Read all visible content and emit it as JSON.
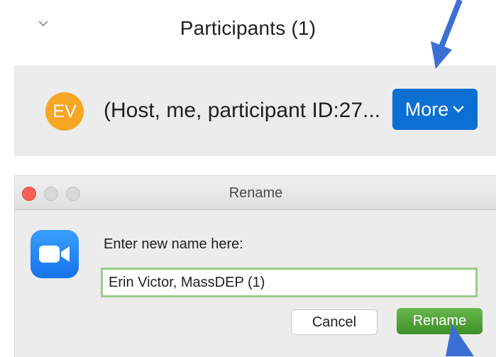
{
  "participants_panel": {
    "title": "Participants (1)",
    "participant": {
      "initials": "EV",
      "name_text": "(Host, me, participant ID:27...",
      "avatar_color": "#f5a623"
    },
    "more_button_label": "More"
  },
  "rename_dialog": {
    "title": "Rename",
    "prompt": "Enter new name here:",
    "name_value": "Erin Victor, MassDEP (1)",
    "cancel_label": "Cancel",
    "rename_label": "Rename"
  },
  "colors": {
    "accent_blue": "#0b6fd3",
    "rename_green": "#4ea535",
    "arrow_blue": "#3b6fd4"
  },
  "icons": [
    "chevron-down-icon",
    "zoom-camera-icon",
    "pointer-arrow-icon"
  ]
}
